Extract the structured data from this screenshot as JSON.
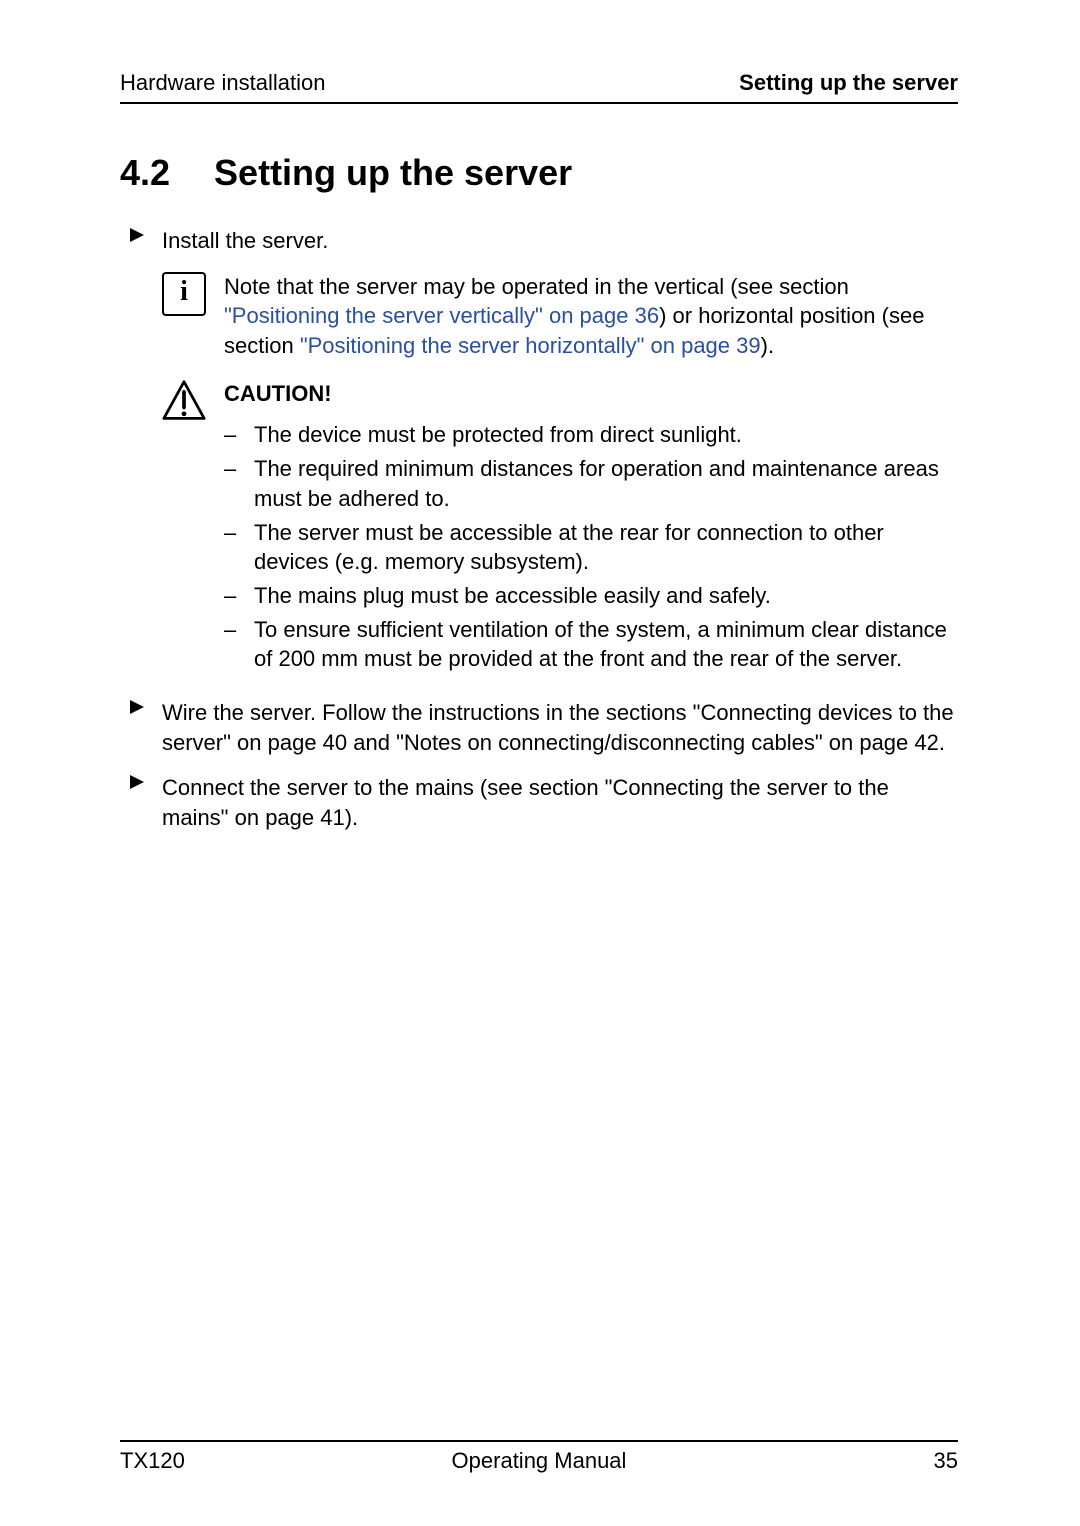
{
  "header": {
    "left": "Hardware installation",
    "right": "Setting up the server"
  },
  "heading": {
    "number": "4.2",
    "title": "Setting up the server"
  },
  "step1": "Install the server.",
  "note": {
    "pre": "Note that the server may be operated in the vertical (see section ",
    "link1": "\"Positioning the server vertically\" on page 36",
    "mid": ") or horizontal position (see section ",
    "link2": "\"Positioning the server horizontally\" on page 39",
    "post": ")."
  },
  "caution": {
    "title": "CAUTION!",
    "items": [
      "The device must be protected from direct sunlight.",
      "The required minimum distances for operation and maintenance areas must be adhered to.",
      "The server must be accessible at the rear for connection to other devices (e.g. memory subsystem).",
      "The mains plug must be accessible easily and safely.",
      "To ensure sufficient ventilation of the system, a minimum clear distance of 200 mm must be provided at the front and the rear of the server."
    ]
  },
  "step2": {
    "pre": "Wire the server. Follow the instructions in the sections ",
    "link1": "\"Connecting devices to the server\" on page 40",
    "mid": " and ",
    "link2": "\"Notes on connecting/disconnecting cables\" on page 42",
    "post": "."
  },
  "step3": {
    "pre": "Connect the server to the mains (see section ",
    "link1": "\"Connecting the server to the mains\" on page 41",
    "post": ")."
  },
  "footer": {
    "left": "TX120",
    "center": "Operating Manual",
    "right": "35"
  }
}
